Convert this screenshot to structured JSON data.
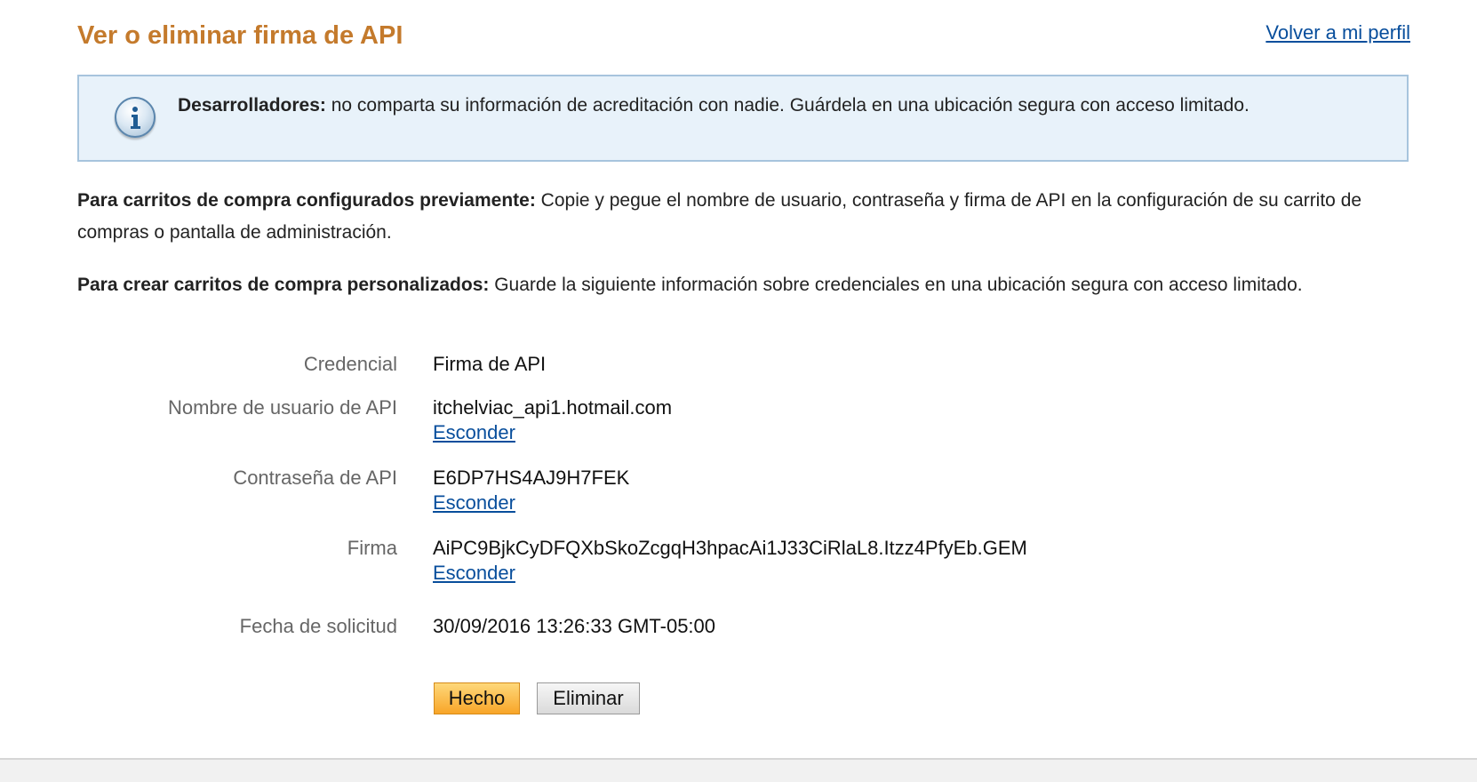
{
  "header": {
    "title": "Ver o eliminar firma de API",
    "back_link": "Volver a mi perfil"
  },
  "notice": {
    "icon": "info-icon",
    "bold": "Desarrolladores:",
    "text": " no comparta su información de acreditación con nadie. Guárdela en una ubicación segura con acceso limitado."
  },
  "instructions": [
    {
      "bold": "Para carritos de compra configurados previamente:",
      "text": " Copie y pegue el nombre de usuario, contraseña y firma de API en la configuración de su carrito de compras o pantalla de administración."
    },
    {
      "bold": "Para crear carritos de compra personalizados:",
      "text": " Guarde la siguiente información sobre credenciales en una ubicación segura con acceso limitado."
    }
  ],
  "credentials": {
    "credential": {
      "label": "Credencial",
      "value": "Firma de API"
    },
    "username": {
      "label": "Nombre de usuario de API",
      "value": "itchelviac_api1.hotmail.com",
      "hide": "Esconder"
    },
    "password": {
      "label": "Contraseña de API",
      "value": "E6DP7HS4AJ9H7FEK",
      "hide": "Esconder"
    },
    "signature": {
      "label": "Firma",
      "value": "AiPC9BjkCyDFQXbSkoZcgqH3hpacAi1J33CiRlaL8.Itzz4PfyEb.GEM",
      "hide": "Esconder"
    },
    "date": {
      "label": "Fecha de solicitud",
      "value": "30/09/2016 13:26:33 GMT-05:00"
    }
  },
  "actions": {
    "done": "Hecho",
    "delete": "Eliminar"
  },
  "colors": {
    "title": "#c47a2c",
    "link": "#084e9c",
    "notice_bg": "#e8f2fa",
    "notice_border": "#a7c4dd",
    "primary_button": "#f8a528"
  }
}
